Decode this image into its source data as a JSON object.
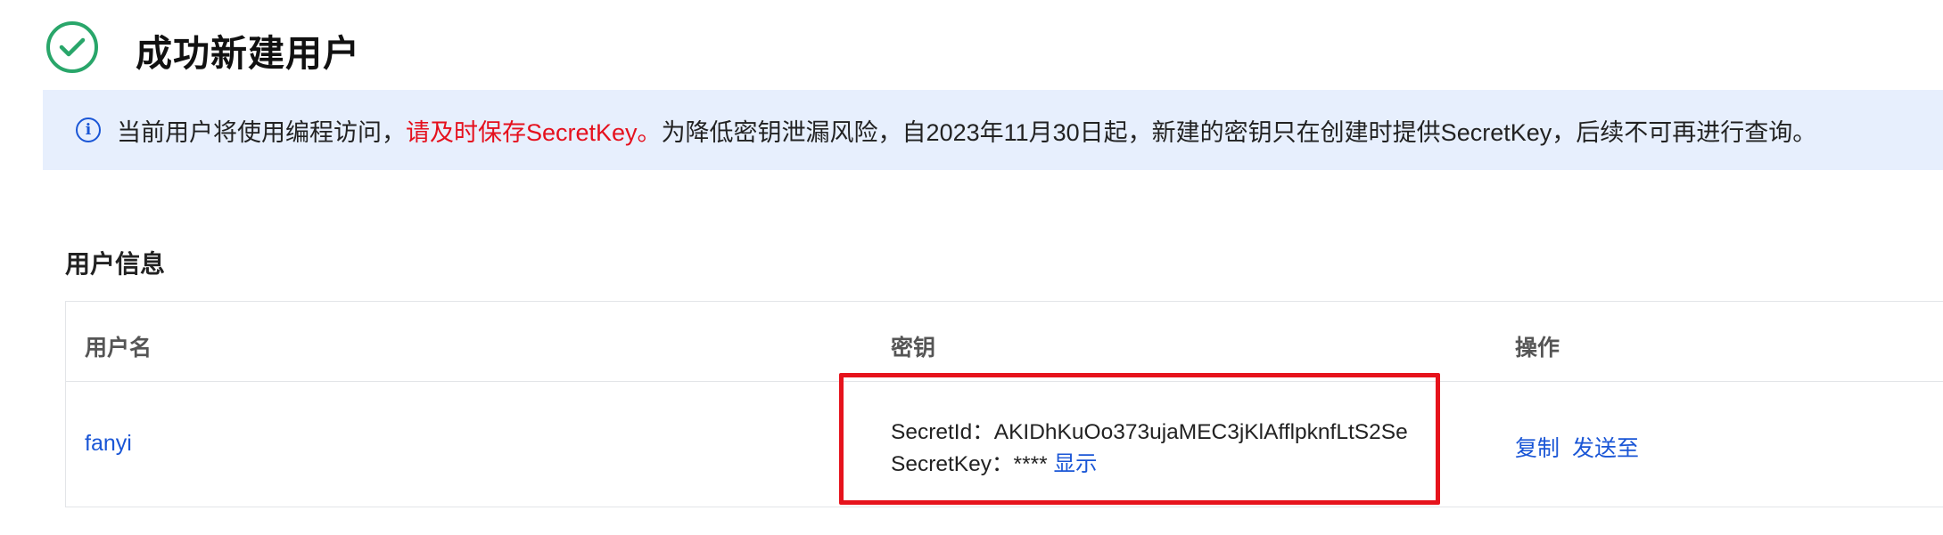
{
  "header": {
    "title": "成功新建用户"
  },
  "notice": {
    "text_before": "当前用户将使用编程访问，",
    "text_highlight": "请及时保存SecretKey。",
    "text_after": "为降低密钥泄漏风险，自2023年11月30日起，新建的密钥只在创建时提供SecretKey，后续不可再进行查询。"
  },
  "user_info": {
    "section_title": "用户信息",
    "columns": [
      "用户名",
      "密钥",
      "操作"
    ],
    "row": {
      "username": "fanyi",
      "secret_id_label": "SecretId：",
      "secret_id_value": "AKIDhKuOo373ujaMEC3jKlAfflpknfLtS2Se",
      "secret_key_label": "SecretKey：",
      "secret_key_value": "****",
      "show_label": "显示",
      "actions": [
        "复制",
        "发送至"
      ]
    }
  },
  "colors": {
    "success": "#29a66a",
    "link": "#1a56d6",
    "warning": "#e5101d",
    "notice_bg": "#e7effd",
    "highlight_box": "#e6131c"
  },
  "icons": {
    "success": "check-circle-icon",
    "info": "info-circle-icon"
  }
}
